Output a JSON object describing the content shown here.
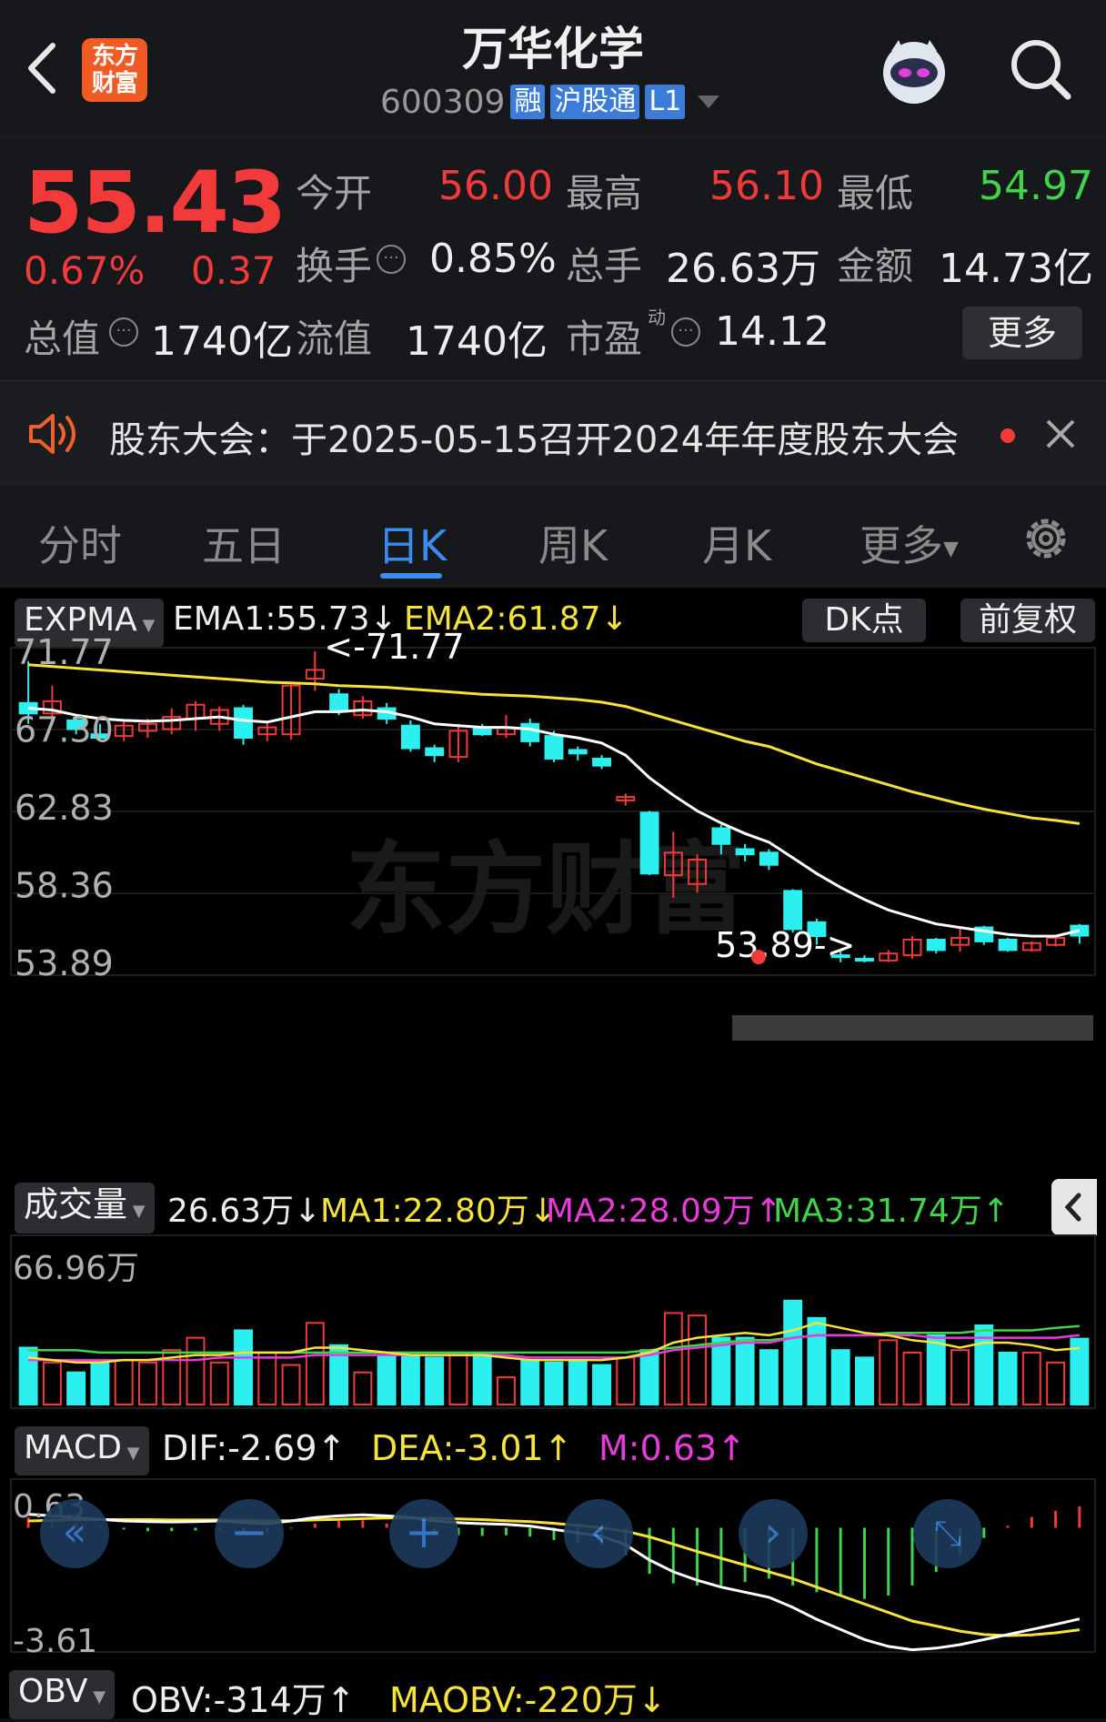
{
  "header": {
    "title": "万华化学",
    "code": "600309",
    "tags": [
      "融",
      "沪股通",
      "L1"
    ],
    "logo": "东方财富",
    "icons": [
      "back-arrow-icon",
      "robot-avatar-icon",
      "search-icon"
    ]
  },
  "quote": {
    "price": "55.43",
    "change_pct": "0.67%",
    "change": "0.37",
    "open_label": "今开",
    "open": "56.00",
    "high_label": "最高",
    "high": "56.10",
    "low_label": "最低",
    "low": "54.97",
    "turnover_label": "换手",
    "turnover": "0.85%",
    "volume_label": "总手",
    "volume": "26.63万",
    "amount_label": "金额",
    "amount": "14.73亿",
    "mktcap_label": "总值",
    "mktcap": "1740亿",
    "float_label": "流值",
    "float": "1740亿",
    "pe_label": "市盈",
    "pe_sup": "动",
    "pe": "14.12",
    "more_label": "更多"
  },
  "notice": {
    "text": "股东大会：于2025-05-15召开2024年年度股东大会"
  },
  "tabs": {
    "items": [
      "分时",
      "五日",
      "日K",
      "周K",
      "月K",
      "更多"
    ],
    "active": "日K"
  },
  "colors": {
    "up": "#f23a3a",
    "down": "#2cf0f0",
    "ema1": "#ffffff",
    "ema2": "#f5e23a",
    "ma2": "#e83cda",
    "ma3": "#3fd44c",
    "bg": "#000000",
    "accent": "#3b8cf0"
  },
  "kline_panel": {
    "indicator": "EXPMA",
    "ema1": "EMA1:55.73↓",
    "ema2": "EMA2:61.87↓",
    "dk_button": "DK点",
    "adjust_button": "前复权",
    "y_labels": [
      "71.77",
      "67.30",
      "62.83",
      "58.36",
      "53.89"
    ],
    "high_mark": "<-71.77",
    "low_mark": "53.89->",
    "watermark": "东方财富"
  },
  "volume_panel": {
    "indicator": "成交量",
    "vol": "26.63万↓",
    "ma1": "MA1:22.80万↓",
    "ma2": "MA2:28.09万↑",
    "ma3": "MA3:31.74万↑",
    "y_label": "66.96万"
  },
  "macd_panel": {
    "indicator": "MACD",
    "dif": "DIF:-2.69↑",
    "dea": "DEA:-3.01↑",
    "m": "M:0.63↑",
    "y_top": "0.63",
    "y_bottom": "-3.61"
  },
  "obv_panel": {
    "indicator": "OBV",
    "obv": "OBV:-314万↑",
    "maobv": "MAOBV:-220万↓"
  },
  "chart_data": {
    "type": "candlestick",
    "ylim": [
      53.89,
      71.77
    ],
    "candles": [
      {
        "o": 68.8,
        "h": 71.2,
        "l": 67.6,
        "c": 68.2
      },
      {
        "o": 68.2,
        "h": 69.8,
        "l": 67.9,
        "c": 68.9
      },
      {
        "o": 67.8,
        "h": 68.1,
        "l": 67.0,
        "c": 67.3
      },
      {
        "o": 67.0,
        "h": 67.6,
        "l": 66.6,
        "c": 66.8
      },
      {
        "o": 66.9,
        "h": 67.8,
        "l": 66.6,
        "c": 67.5
      },
      {
        "o": 67.2,
        "h": 67.9,
        "l": 66.8,
        "c": 67.6
      },
      {
        "o": 67.3,
        "h": 68.5,
        "l": 67.0,
        "c": 68.0
      },
      {
        "o": 67.9,
        "h": 68.9,
        "l": 67.2,
        "c": 68.7
      },
      {
        "o": 67.6,
        "h": 68.6,
        "l": 67.2,
        "c": 68.4
      },
      {
        "o": 68.5,
        "h": 68.7,
        "l": 66.4,
        "c": 66.8
      },
      {
        "o": 67.0,
        "h": 67.8,
        "l": 66.6,
        "c": 67.4
      },
      {
        "o": 67.0,
        "h": 70.0,
        "l": 66.7,
        "c": 69.8
      },
      {
        "o": 70.2,
        "h": 71.77,
        "l": 69.5,
        "c": 70.7
      },
      {
        "o": 69.3,
        "h": 69.6,
        "l": 68.1,
        "c": 68.3
      },
      {
        "o": 68.1,
        "h": 69.2,
        "l": 67.9,
        "c": 68.9
      },
      {
        "o": 68.5,
        "h": 68.8,
        "l": 67.6,
        "c": 67.9
      },
      {
        "o": 67.5,
        "h": 67.8,
        "l": 66.0,
        "c": 66.2
      },
      {
        "o": 66.2,
        "h": 66.4,
        "l": 65.4,
        "c": 65.8
      },
      {
        "o": 65.7,
        "h": 67.6,
        "l": 65.4,
        "c": 67.2
      },
      {
        "o": 67.3,
        "h": 67.6,
        "l": 66.9,
        "c": 67.0
      },
      {
        "o": 67.0,
        "h": 68.1,
        "l": 66.8,
        "c": 67.4
      },
      {
        "o": 67.6,
        "h": 67.9,
        "l": 66.3,
        "c": 66.6
      },
      {
        "o": 66.9,
        "h": 67.2,
        "l": 65.4,
        "c": 65.6
      },
      {
        "o": 66.1,
        "h": 66.3,
        "l": 65.5,
        "c": 65.9
      },
      {
        "o": 65.6,
        "h": 65.8,
        "l": 65.0,
        "c": 65.2
      },
      {
        "o": 63.2,
        "h": 63.6,
        "l": 62.9,
        "c": 63.4
      },
      {
        "o": 62.5,
        "h": 62.6,
        "l": 58.9,
        "c": 59.0
      },
      {
        "o": 58.9,
        "h": 61.4,
        "l": 57.6,
        "c": 60.2
      },
      {
        "o": 58.4,
        "h": 60.1,
        "l": 57.9,
        "c": 59.8
      },
      {
        "o": 61.6,
        "h": 61.8,
        "l": 60.1,
        "c": 60.7
      },
      {
        "o": 60.4,
        "h": 60.7,
        "l": 59.7,
        "c": 60.1
      },
      {
        "o": 60.2,
        "h": 60.4,
        "l": 59.2,
        "c": 59.5
      },
      {
        "o": 58.0,
        "h": 58.1,
        "l": 55.6,
        "c": 55.8
      },
      {
        "o": 56.2,
        "h": 56.4,
        "l": 54.9,
        "c": 55.4
      },
      {
        "o": 54.3,
        "h": 54.5,
        "l": 53.9,
        "c": 54.2
      },
      {
        "o": 54.1,
        "h": 54.3,
        "l": 53.89,
        "c": 54.0
      },
      {
        "o": 54.0,
        "h": 54.6,
        "l": 53.9,
        "c": 54.4
      },
      {
        "o": 54.3,
        "h": 55.4,
        "l": 54.1,
        "c": 55.2
      },
      {
        "o": 55.2,
        "h": 55.3,
        "l": 54.4,
        "c": 54.6
      },
      {
        "o": 54.9,
        "h": 55.9,
        "l": 54.5,
        "c": 55.3
      },
      {
        "o": 55.9,
        "h": 56.0,
        "l": 54.9,
        "c": 55.1
      },
      {
        "o": 55.2,
        "h": 55.3,
        "l": 54.5,
        "c": 54.6
      },
      {
        "o": 54.6,
        "h": 55.1,
        "l": 54.5,
        "c": 55.0
      },
      {
        "o": 54.9,
        "h": 55.4,
        "l": 54.8,
        "c": 55.3
      },
      {
        "o": 56.0,
        "h": 56.1,
        "l": 54.97,
        "c": 55.43
      }
    ],
    "ema1": [
      68.5,
      68.4,
      68.1,
      67.9,
      67.8,
      67.75,
      67.8,
      67.9,
      68.0,
      67.8,
      67.7,
      68.0,
      68.3,
      68.3,
      68.4,
      68.3,
      68.0,
      67.6,
      67.5,
      67.4,
      67.4,
      67.3,
      67.0,
      66.8,
      66.5,
      65.8,
      64.5,
      63.5,
      62.6,
      61.9,
      61.3,
      60.8,
      59.9,
      59.0,
      58.2,
      57.5,
      56.9,
      56.5,
      56.1,
      55.9,
      55.7,
      55.5,
      55.4,
      55.4,
      55.73
    ],
    "ema2": [
      71.0,
      70.9,
      70.8,
      70.7,
      70.6,
      70.5,
      70.4,
      70.3,
      70.2,
      70.1,
      70.0,
      69.95,
      69.9,
      69.8,
      69.75,
      69.7,
      69.6,
      69.5,
      69.4,
      69.3,
      69.25,
      69.2,
      69.1,
      69.0,
      68.85,
      68.6,
      68.2,
      67.8,
      67.4,
      67.0,
      66.6,
      66.3,
      65.8,
      65.3,
      64.9,
      64.5,
      64.1,
      63.7,
      63.35,
      63.0,
      62.7,
      62.45,
      62.2,
      62.05,
      61.87
    ],
    "volume": [
      23,
      17,
      13,
      17,
      18,
      17,
      22,
      27,
      17,
      30,
      21,
      16,
      33,
      24,
      13,
      20,
      20,
      19,
      21,
      21,
      11,
      18,
      17,
      18,
      16,
      19,
      22,
      37,
      36,
      27,
      27,
      22,
      42,
      35,
      22,
      19,
      26,
      21,
      28,
      22,
      32,
      21,
      21,
      17,
      26.63
    ],
    "vol_ma1": [
      19,
      18,
      17,
      17,
      18,
      18,
      19,
      20,
      20,
      21,
      21,
      21,
      23,
      23,
      22,
      21,
      20,
      20,
      20,
      20,
      19,
      18,
      18,
      18,
      18,
      19,
      21,
      25,
      27,
      28,
      29,
      28,
      30,
      33,
      31,
      29,
      28,
      26,
      25,
      23,
      25,
      25,
      24,
      22,
      22.8
    ],
    "vol_ma2": [
      18,
      18,
      18,
      18,
      18,
      18,
      18,
      18,
      19,
      19,
      19,
      19,
      20,
      20,
      20,
      20,
      20,
      20,
      20,
      20,
      20,
      19,
      19,
      19,
      19,
      19,
      20,
      22,
      23,
      24,
      25,
      25,
      27,
      28,
      28,
      28,
      28,
      28,
      27,
      27,
      27,
      27,
      27,
      27,
      28.09
    ],
    "vol_ma3": [
      22,
      22,
      22,
      21,
      21,
      21,
      21,
      21,
      21,
      21,
      21,
      21,
      21,
      21,
      21,
      21,
      21,
      21,
      21,
      21,
      21,
      21,
      21,
      21,
      21,
      21,
      22,
      23,
      24,
      25,
      26,
      26,
      27,
      28,
      28,
      28,
      29,
      29,
      29,
      29,
      30,
      30,
      30,
      31,
      31.74
    ],
    "macd_dif": [
      0.4,
      0.35,
      0.3,
      0.25,
      0.2,
      0.18,
      0.17,
      0.18,
      0.2,
      0.15,
      0.12,
      0.2,
      0.3,
      0.35,
      0.38,
      0.35,
      0.3,
      0.2,
      0.15,
      0.12,
      0.1,
      0.05,
      -0.05,
      -0.15,
      -0.25,
      -0.5,
      -0.95,
      -1.3,
      -1.55,
      -1.75,
      -1.9,
      -2.05,
      -2.35,
      -2.7,
      -3.0,
      -3.3,
      -3.5,
      -3.6,
      -3.55,
      -3.45,
      -3.3,
      -3.15,
      -3.0,
      -2.85,
      -2.69
    ],
    "macd_dea": [
      0.2,
      0.22,
      0.24,
      0.24,
      0.24,
      0.24,
      0.23,
      0.23,
      0.23,
      0.22,
      0.21,
      0.21,
      0.23,
      0.25,
      0.27,
      0.29,
      0.29,
      0.28,
      0.26,
      0.24,
      0.21,
      0.18,
      0.13,
      0.07,
      0.0,
      -0.1,
      -0.27,
      -0.48,
      -0.7,
      -0.9,
      -1.1,
      -1.3,
      -1.5,
      -1.75,
      -2.0,
      -2.25,
      -2.5,
      -2.75,
      -2.9,
      -3.05,
      -3.15,
      -3.18,
      -3.16,
      -3.1,
      -3.01
    ],
    "macd_m": [
      0.3,
      0.25,
      0.15,
      0.05,
      -0.05,
      -0.1,
      -0.1,
      -0.08,
      -0.06,
      -0.12,
      -0.14,
      -0.02,
      0.12,
      0.2,
      0.22,
      0.12,
      0.02,
      -0.16,
      -0.22,
      -0.24,
      -0.22,
      -0.26,
      -0.36,
      -0.44,
      -0.5,
      -0.8,
      -1.36,
      -1.64,
      -1.7,
      -1.7,
      -1.6,
      -1.5,
      -1.7,
      -1.9,
      -2.0,
      -2.1,
      -2.0,
      -1.7,
      -1.3,
      -0.8,
      -0.3,
      0.06,
      0.32,
      0.5,
      0.63
    ],
    "macd_ylim": [
      -3.61,
      0.63
    ]
  }
}
